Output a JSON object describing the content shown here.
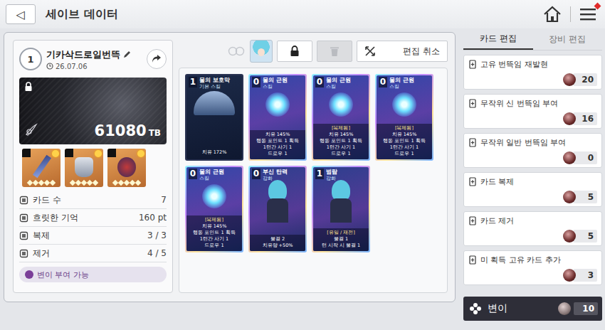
{
  "header": {
    "back": "◁",
    "title": "세이브 데이터",
    "notification": true
  },
  "save": {
    "rank": "1",
    "name": "기카삭드로일번뜩",
    "date": "26.07.06",
    "score": "61080",
    "unit": "TB",
    "locked": true
  },
  "toolbar": {
    "locked": true,
    "delete_disabled": true,
    "cancel": "편집 취소"
  },
  "equipment": [
    {
      "kind": "weapon",
      "stars": 5
    },
    {
      "kind": "armor",
      "stars": 5
    },
    {
      "kind": "accessory",
      "stars": 5
    }
  ],
  "stats": [
    {
      "label": "카드 수",
      "value": "7"
    },
    {
      "label": "흐릿한 기억",
      "value": "160 pt"
    },
    {
      "label": "복제",
      "value": "3 / 3"
    },
    {
      "label": "제거",
      "value": "4 / 5"
    }
  ],
  "mutation_badge": "변이 부여 가능",
  "cards": [
    {
      "cost": "1",
      "name": "물의 보호막",
      "type": "기본 스킬",
      "kind": "basic",
      "tag": "",
      "lines": [
        "치유 172%"
      ]
    },
    {
      "cost": "0",
      "name": "물의 근원",
      "type": "스킬",
      "kind": "skill",
      "tag": "",
      "lines": [
        "치유 145%",
        "행동 포인트 1 획득",
        "1턴간 사기 1",
        "드로우 1"
      ]
    },
    {
      "cost": "0",
      "name": "물의 근원",
      "type": "스킬",
      "kind": "skill",
      "tag": "[복제됨]",
      "lines": [
        "치유 145%",
        "행동 포인트 1 획득",
        "1턴간 사기 1",
        "드로우 1"
      ]
    },
    {
      "cost": "0",
      "name": "물의 근원",
      "type": "스킬",
      "kind": "skill",
      "tag": "[복제됨]",
      "lines": [
        "치유 145%",
        "행동 포인트 1 획득",
        "1턴간 사기 1",
        "드로우 1"
      ]
    },
    {
      "cost": "0",
      "name": "물의 근원",
      "type": "스킬",
      "kind": "skill",
      "tag": "[복제됨]",
      "lines": [
        "치유 145%",
        "행동 포인트 1 획득",
        "1턴간 사기 1",
        "드로우 1"
      ]
    },
    {
      "cost": "0",
      "name": "부신 탄력",
      "type": "강화",
      "kind": "enhance",
      "tag": "",
      "lines": [
        "물결 2",
        "치유량 +50%"
      ]
    },
    {
      "cost": "1",
      "name": "범람",
      "type": "강화",
      "kind": "enhance",
      "tag": "[유일 / 재전]",
      "lines": [
        "물결 1",
        "턴 시작 시 물결 1"
      ]
    }
  ],
  "tabs": [
    {
      "label": "카드 편집",
      "selected": true
    },
    {
      "label": "장비 편집",
      "selected": false
    }
  ],
  "actions": [
    {
      "label": "고유 번뜩임 재발현",
      "count": "20",
      "selected": false
    },
    {
      "label": "무작위 신 번뜩임 부여",
      "count": "16",
      "selected": false
    },
    {
      "label": "무작위 일반 번뜩임 부여",
      "count": "0",
      "selected": false
    },
    {
      "label": "카드 복제",
      "count": "5",
      "selected": false
    },
    {
      "label": "카드 제거",
      "count": "5",
      "selected": false
    },
    {
      "label": "미 획득 고유 카드 추가",
      "count": "3",
      "selected": false
    },
    {
      "label": "변이",
      "count": "10",
      "selected": true
    }
  ]
}
